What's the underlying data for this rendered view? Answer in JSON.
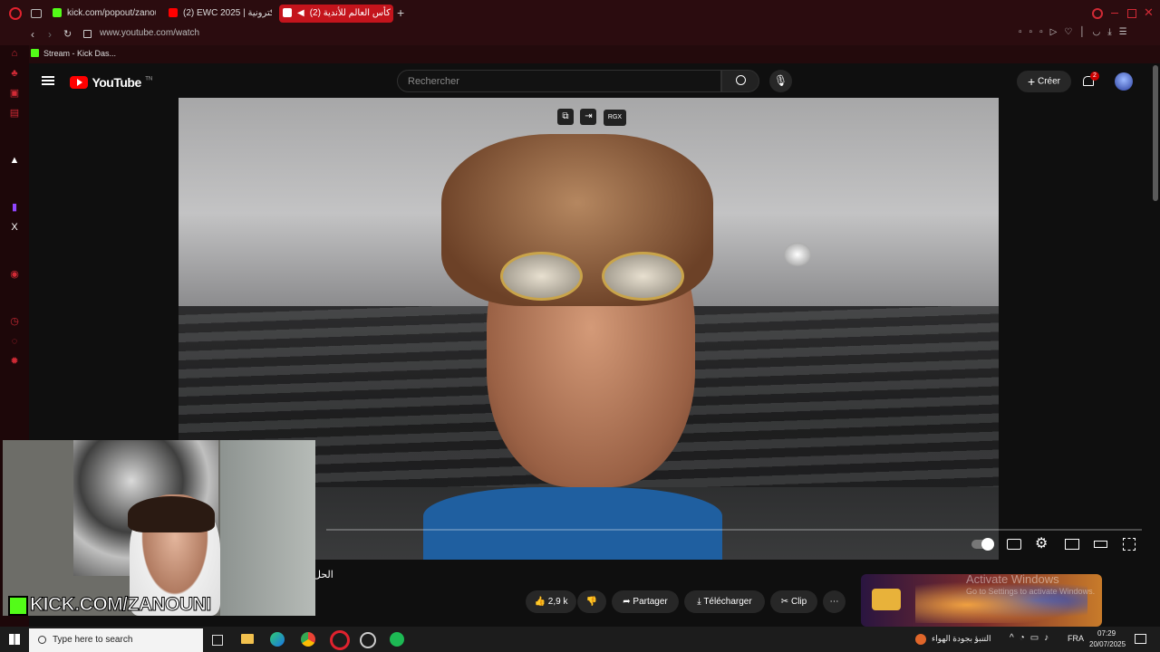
{
  "browser": {
    "tabs": [
      {
        "label": "kick.com/popout/zanouni",
        "favicon": "kick-icon"
      },
      {
        "label": "(2) EWC 2025 | الإلكترونية",
        "favicon": "youtube-icon"
      },
      {
        "label": "(2) كأس العالم للأندية - ·",
        "favicon": "youtube-icon"
      }
    ],
    "url": "www.youtube.com/watch",
    "bookmark": "Stream - Kick Das..."
  },
  "youtube": {
    "logo_text": "YouTube",
    "region": "TN",
    "search_placeholder": "Rechercher",
    "create_label": "Créer",
    "notification_count": "2",
    "video_overlay_label": "RGX",
    "title_fragment": "الحل",
    "like_count": "2,9 k",
    "share_label": "Partager",
    "download_label": "Télécharger",
    "clip_label": "Clip",
    "progress": 0.0
  },
  "overlay": {
    "watermark_title": "Activate Windows",
    "watermark_sub": "Go to Settings to activate Windows.",
    "kick_text": "KICK.COM/ZANOUNI"
  },
  "taskbar": {
    "search_placeholder": "Type here to search",
    "weather": "التنبؤ بجودة الهواء",
    "language": "FRA",
    "time": "07:29",
    "date": "20/07/2025"
  },
  "colors": {
    "accent": "#c4141c",
    "kick_green": "#53fc18",
    "yt_red": "#ff0000"
  }
}
